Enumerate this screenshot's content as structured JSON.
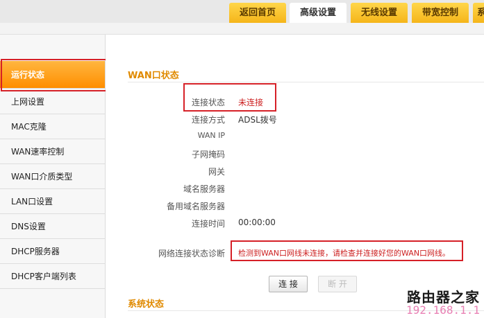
{
  "tabs": [
    "返回首页",
    "高级设置",
    "无线设置",
    "带宽控制",
    "系"
  ],
  "sidebar": {
    "items": [
      {
        "label": "运行状态"
      },
      {
        "label": "上网设置"
      },
      {
        "label": "MAC克隆"
      },
      {
        "label": "WAN速率控制"
      },
      {
        "label": "WAN口介质类型"
      },
      {
        "label": "LAN口设置"
      },
      {
        "label": "DNS设置"
      },
      {
        "label": "DHCP服务器"
      },
      {
        "label": "DHCP客户端列表"
      }
    ]
  },
  "wan": {
    "title": "WAN口状态",
    "rows": [
      {
        "label": "连接状态",
        "value": "未连接"
      },
      {
        "label": "连接方式",
        "value": "ADSL拨号"
      },
      {
        "label": "WAN IP",
        "value": ""
      },
      {
        "label": "子网掩码",
        "value": ""
      },
      {
        "label": "网关",
        "value": ""
      },
      {
        "label": "域名服务器",
        "value": ""
      },
      {
        "label": "备用域名服务器",
        "value": ""
      },
      {
        "label": "连接时间",
        "value": "00:00:00"
      }
    ],
    "diagnosis_label": "网络连接状态诊断",
    "diagnosis_value": "检测到WAN口网线未连接，请检查并连接好您的WAN口网线。",
    "connect_button": "连 接",
    "disconnect_button": "断 开"
  },
  "system": {
    "title": "系统状态"
  },
  "watermark": {
    "title": "路由器之家",
    "url": "192.168.1.1"
  }
}
